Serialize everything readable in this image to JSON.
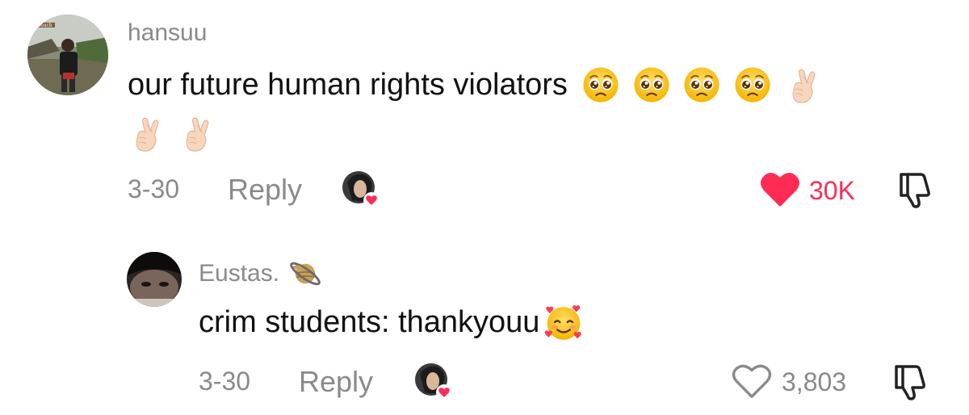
{
  "comment": {
    "username": "hansuu",
    "text": "our future human rights violators",
    "date": "3-30",
    "reply_label": "Reply",
    "like_count": "30K",
    "liked": true,
    "like_color": "#fe2c55"
  },
  "reply": {
    "username": "Eustas.",
    "text": "crim students: thankyouu",
    "date": "3-30",
    "reply_label": "Reply",
    "like_count": "3,803",
    "liked": false
  },
  "icons": {
    "pleading_face": "pleading-face-emoji",
    "hand": "fingers-crossed-emoji",
    "planet": "ringed-planet-emoji",
    "smiling_hearts": "smiling-face-with-hearts-emoji",
    "heart": "heart-icon",
    "dislike": "thumbs-down-icon"
  }
}
